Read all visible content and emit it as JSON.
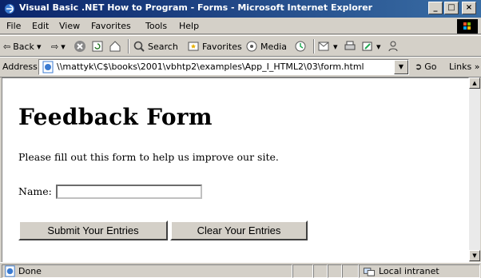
{
  "window": {
    "title": "Visual Basic .NET How to Program - Forms - Microsoft Internet Explorer",
    "controls": [
      "_",
      "□",
      "×"
    ]
  },
  "menu": [
    "File",
    "Edit",
    "View",
    "Favorites",
    "Tools",
    "Help"
  ],
  "toolbar": {
    "back_label": "Back",
    "search_label": "Search",
    "favorites_label": "Favorites",
    "media_label": "Media"
  },
  "address": {
    "label": "Address",
    "url": "\\\\mattyk\\C$\\books\\2001\\vbhtp2\\examples\\App_I_HTML2\\03\\form.html",
    "go_label": "Go",
    "links_label": "Links »"
  },
  "page": {
    "heading": "Feedback Form",
    "intro": "Please fill out this form to help us improve our site.",
    "name_label": "Name:",
    "name_value": "",
    "submit_label": "Submit Your Entries",
    "clear_label": "Clear Your Entries"
  },
  "status": {
    "text": "Done",
    "zone": "Local intranet"
  },
  "colors": {
    "title_gradient_start": "#0a246a",
    "title_gradient_end": "#3a6ea5",
    "chrome": "#d4d0c8"
  }
}
